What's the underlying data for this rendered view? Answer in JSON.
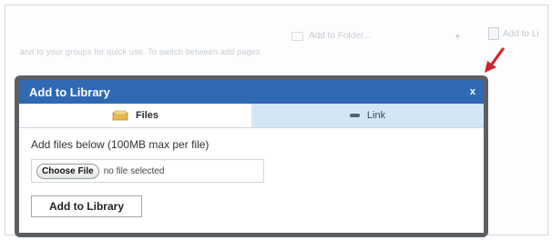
{
  "background_toolbar": {
    "folder_label": "Add to Folder...",
    "add_to_library_label": "Add to Li",
    "description": "and to your groups for quick use. To switch between add pages"
  },
  "modal": {
    "title": "Add to Library",
    "close_label": "x",
    "tabs": [
      {
        "label": "Files",
        "icon": "folder-icon",
        "active": true
      },
      {
        "label": "Link",
        "icon": "link-icon",
        "active": false
      }
    ],
    "help_text": "Add files below (100MB max per file)",
    "file_input": {
      "button_label": "Choose File",
      "status": "no file selected"
    },
    "submit_label": "Add to Library"
  },
  "colors": {
    "header_blue": "#2f69b4",
    "modal_frame": "#5b5f63",
    "inactive_tab": "#d3e6f5",
    "arrow_red": "#d1242a"
  }
}
